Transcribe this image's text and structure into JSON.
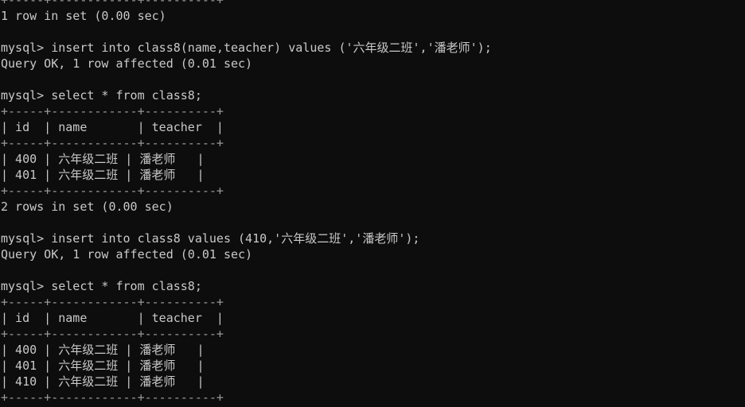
{
  "terminal": {
    "background_color": "#0d0d0d",
    "foreground_color": "#c9c9c9",
    "rule_color": "#9a9a9a",
    "prompt": "mysql>",
    "columns": 95,
    "rows": 26
  },
  "table_schema": {
    "columns": [
      "id",
      "name",
      "teacher"
    ],
    "widths": [
      5,
      12,
      10
    ],
    "rule": "+-----+------------+----------+",
    "header_row": "| id  | name       | teacher  |"
  },
  "lines": [
    {
      "id": "l00",
      "type": "rule",
      "text": "+-----+------------+----------+"
    },
    {
      "id": "l01",
      "type": "output",
      "text": "1 row in set (0.00 sec)"
    },
    {
      "id": "l02",
      "type": "blank",
      "text": ""
    },
    {
      "id": "l03",
      "type": "command",
      "text": "mysql> insert into class8(name,teacher) values ('六年级二班','潘老师');"
    },
    {
      "id": "l04",
      "type": "output",
      "text": "Query OK, 1 row affected (0.01 sec)"
    },
    {
      "id": "l05",
      "type": "blank",
      "text": ""
    },
    {
      "id": "l06",
      "type": "command",
      "text": "mysql> select * from class8;"
    },
    {
      "id": "l07",
      "type": "rule",
      "text": "+-----+------------+----------+"
    },
    {
      "id": "l08",
      "type": "header",
      "text": "| id  | name       | teacher  |"
    },
    {
      "id": "l09",
      "type": "rule",
      "text": "+-----+------------+----------+"
    },
    {
      "id": "l10",
      "type": "row",
      "text": "| 400 | 六年级二班 | 潘老师   |"
    },
    {
      "id": "l11",
      "type": "row",
      "text": "| 401 | 六年级二班 | 潘老师   |"
    },
    {
      "id": "l12",
      "type": "rule",
      "text": "+-----+------------+----------+"
    },
    {
      "id": "l13",
      "type": "output",
      "text": "2 rows in set (0.00 sec)"
    },
    {
      "id": "l14",
      "type": "blank",
      "text": ""
    },
    {
      "id": "l15",
      "type": "command",
      "text": "mysql> insert into class8 values (410,'六年级二班','潘老师');"
    },
    {
      "id": "l16",
      "type": "output",
      "text": "Query OK, 1 row affected (0.01 sec)"
    },
    {
      "id": "l17",
      "type": "blank",
      "text": ""
    },
    {
      "id": "l18",
      "type": "command",
      "text": "mysql> select * from class8;"
    },
    {
      "id": "l19",
      "type": "rule",
      "text": "+-----+------------+----------+"
    },
    {
      "id": "l20",
      "type": "header",
      "text": "| id  | name       | teacher  |"
    },
    {
      "id": "l21",
      "type": "rule",
      "text": "+-----+------------+----------+"
    },
    {
      "id": "l22",
      "type": "row",
      "text": "| 400 | 六年级二班 | 潘老师   |"
    },
    {
      "id": "l23",
      "type": "row",
      "text": "| 401 | 六年级二班 | 潘老师   |"
    },
    {
      "id": "l24",
      "type": "row",
      "text": "| 410 | 六年级二班 | 潘老师   |"
    },
    {
      "id": "l25",
      "type": "rule",
      "text": "+-----+------------+----------+"
    }
  ],
  "result_sets": [
    {
      "id": "result-1",
      "columns": [
        "id",
        "name",
        "teacher"
      ],
      "rows": [
        [
          "400",
          "六年级二班",
          "潘老师"
        ],
        [
          "401",
          "六年级二班",
          "潘老师"
        ]
      ],
      "status": "2 rows in set (0.00 sec)"
    },
    {
      "id": "result-2",
      "columns": [
        "id",
        "name",
        "teacher"
      ],
      "rows": [
        [
          "400",
          "六年级二班",
          "潘老师"
        ],
        [
          "401",
          "六年级二班",
          "潘老师"
        ],
        [
          "410",
          "六年级二班",
          "潘老师"
        ]
      ],
      "status": ""
    }
  ],
  "statuses": {
    "first_visible": "1 row in set (0.00 sec)",
    "insert_1": "Query OK, 1 row affected (0.01 sec)",
    "select_1": "2 rows in set (0.00 sec)",
    "insert_2": "Query OK, 1 row affected (0.01 sec)"
  },
  "commands": {
    "insert_named_columns": "insert into class8(name,teacher) values ('六年级二班','潘老师');",
    "select_all_1": "select * from class8;",
    "insert_with_id": "insert into class8 values (410,'六年级二班','潘老师');",
    "select_all_2": "select * from class8;"
  }
}
